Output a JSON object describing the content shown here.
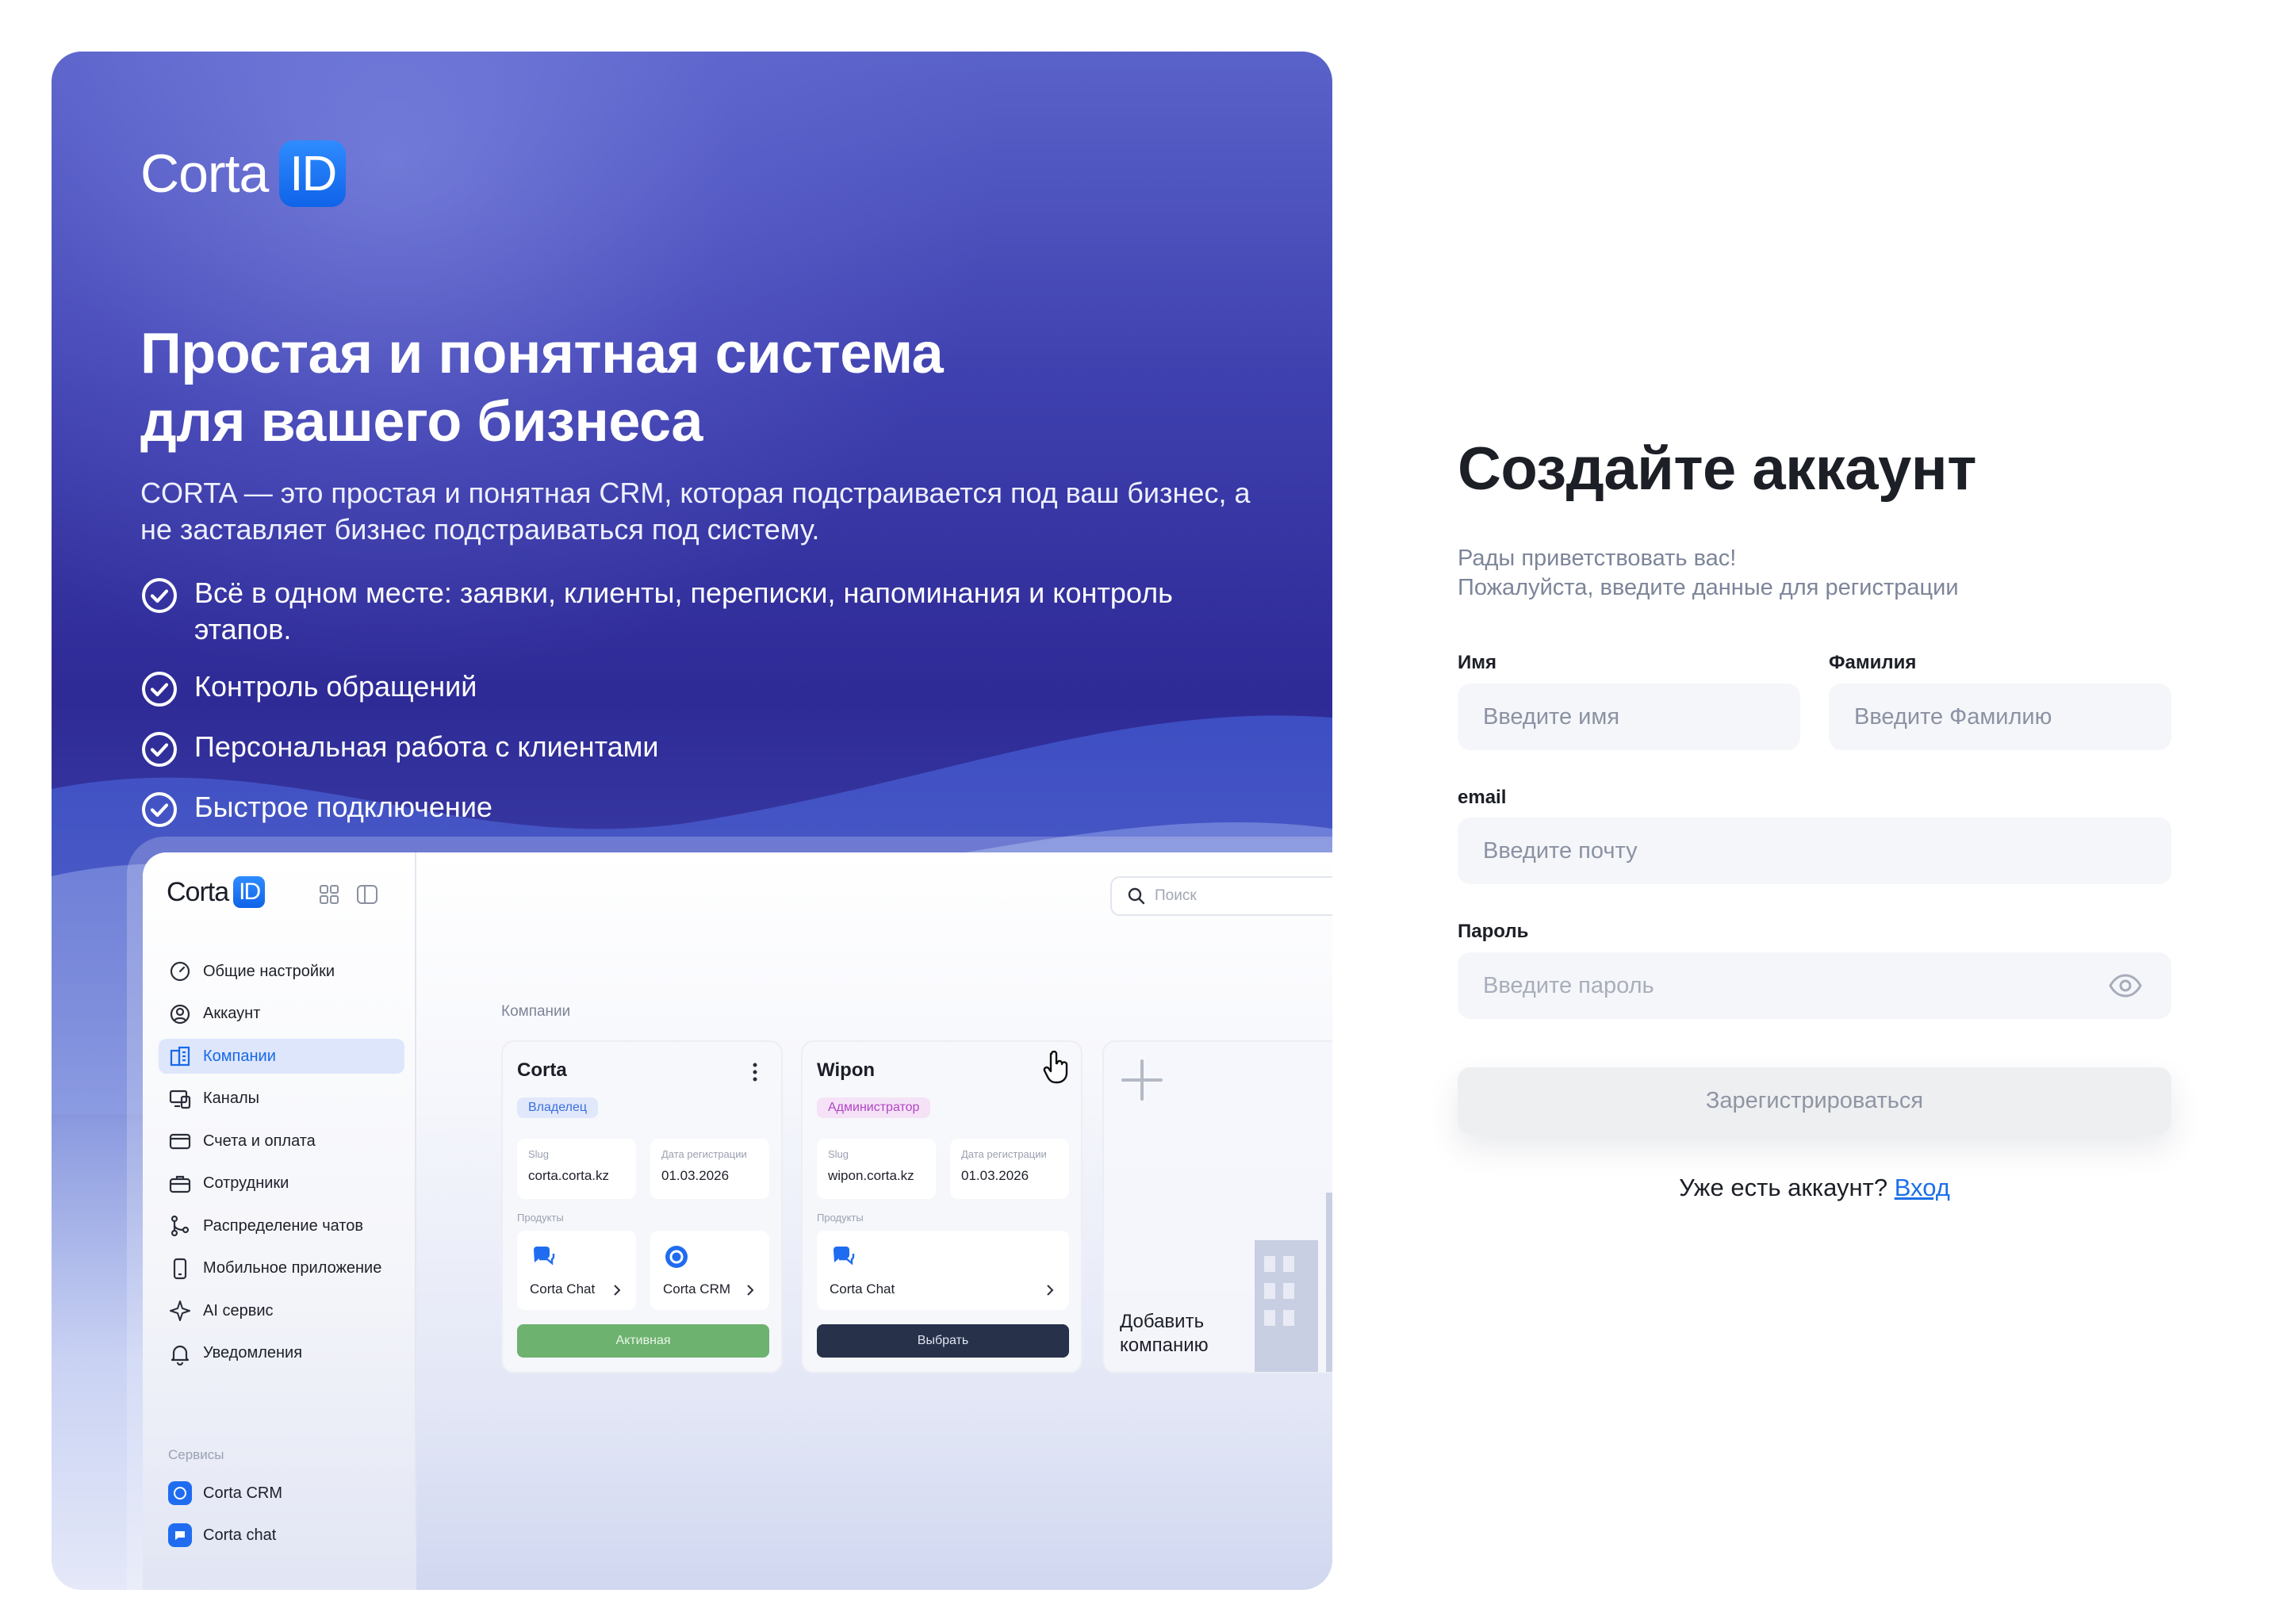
{
  "brand": {
    "word": "Corta",
    "badge": "ID"
  },
  "promo": {
    "title_line1": "Простая и понятная система",
    "title_line2": "для вашего бизнеса",
    "description": "CORTA — это простая и понятная CRM, которая подстраивается под ваш бизнес, а не заставляет бизнес подстраиваться под систему.",
    "features": [
      "Всё в одном месте: заявки, клиенты, переписки, напоминания и контроль этапов.",
      "Контроль обращений",
      "Персональная работа с клиентами",
      "Быстрое подключение"
    ]
  },
  "mockup": {
    "menu": [
      "Общие настройки",
      "Аккаунт",
      "Компании",
      "Каналы",
      "Счета и оплата",
      "Сотрудники",
      "Распределение чатов",
      "Мобильное приложение",
      "AI сервис",
      "Уведомления"
    ],
    "active_menu_index": 2,
    "services_label": "Сервисы",
    "services": [
      "Corta CRM",
      "Corta chat"
    ],
    "search_placeholder": "Поиск",
    "section_title": "Компании",
    "cards": [
      {
        "name": "Corta",
        "role": "Владелец",
        "slug_key": "Slug",
        "slug": "corta.corta.kz",
        "date_key": "Дата регистрации",
        "date": "01.03.2026",
        "products_label": "Продукты",
        "products": [
          "Corta Chat",
          "Corta CRM"
        ],
        "button": "Активная"
      },
      {
        "name": "Wipon",
        "role": "Администратор",
        "slug_key": "Slug",
        "slug": "wipon.corta.kz",
        "date_key": "Дата регистрации",
        "date": "01.03.2026",
        "products_label": "Продукты",
        "products": [
          "Corta Chat"
        ],
        "button": "Выбрать"
      }
    ],
    "add_company": "Добавить компанию"
  },
  "form": {
    "title": "Создайте аккаунт",
    "subtitle_line1": "Рады приветствовать вас!",
    "subtitle_line2": "Пожалуйста, введите данные для регистрации",
    "first_name": {
      "label": "Имя",
      "placeholder": "Введите имя",
      "value": ""
    },
    "last_name": {
      "label": "Фамилия",
      "placeholder": "Введите Фамилию",
      "value": ""
    },
    "email": {
      "label": "email",
      "placeholder": "Введите почту",
      "value": ""
    },
    "password": {
      "label": "Пароль",
      "placeholder": "Введите пароль",
      "value": ""
    },
    "submit": "Зарегистрироваться",
    "have_account": "Уже есть аккаунт?",
    "login_link": "Вход"
  },
  "colors": {
    "accent": "#1c6fe8",
    "promo_dark": "#2e2a96",
    "owner_badge": "#3a6ee0",
    "admin_badge": "#b045c4",
    "active_button": "#6db26f",
    "select_button": "#27314a"
  },
  "icons": {
    "feature": "check-circle-icon",
    "password_toggle": "eye-icon",
    "search": "search-icon"
  }
}
